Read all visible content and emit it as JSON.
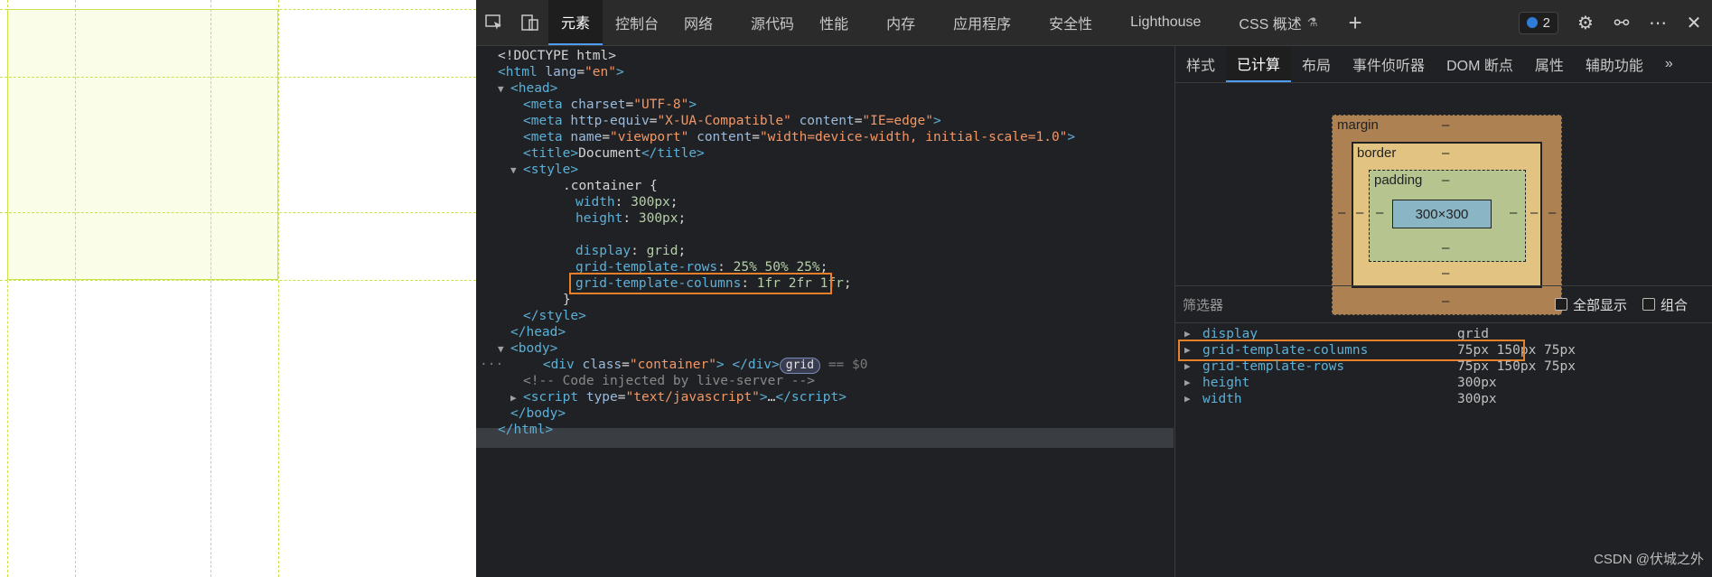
{
  "devtools": {
    "tabs": [
      "元素",
      "控制台",
      "网络",
      "源代码",
      "性能",
      "内存",
      "应用程序",
      "安全性",
      "Lighthouse",
      "CSS 概述"
    ],
    "active_tab": "元素",
    "issues_count": "2"
  },
  "source": {
    "doctype": "<!DOCTYPE html>",
    "html_open": "html",
    "html_lang_attr": "lang",
    "html_lang_val": "\"en\"",
    "head": "head",
    "meta1": {
      "attr": "charset",
      "val": "\"UTF-8\""
    },
    "meta2": {
      "attr1": "http-equiv",
      "val1": "\"X-UA-Compatible\"",
      "attr2": "content",
      "val2": "\"IE=edge\""
    },
    "meta3": {
      "attr1": "name",
      "val1": "\"viewport\"",
      "attr2": "content",
      "val2": "\"width=device-width, initial-scale=1.0\""
    },
    "title_text": "Document",
    "style": "style",
    "css_selector": ".container {",
    "css_rules": [
      {
        "prop": "width",
        "val": "300px"
      },
      {
        "prop": "height",
        "val": "300px"
      },
      {
        "prop": "display",
        "val": "grid"
      },
      {
        "prop": "grid-template-rows",
        "val": "25% 50% 25%"
      },
      {
        "prop": "grid-template-columns",
        "val": "1fr 2fr 1fr"
      }
    ],
    "css_close": "}",
    "body": "body",
    "div_class": "\"container\"",
    "grid_pill": "grid",
    "dollar": "== $0",
    "comment": "<!-- Code injected by live-server -->",
    "script_type": "\"text/javascript\"",
    "ellipsis": "…"
  },
  "right_panel": {
    "tabs": [
      "样式",
      "已计算",
      "布局",
      "事件侦听器",
      "DOM 断点",
      "属性",
      "辅助功能"
    ],
    "active_tab": "已计算",
    "box_model": {
      "margin_label": "margin",
      "border_label": "border",
      "padding_label": "padding",
      "content": "300×300",
      "dash": "–"
    },
    "filter_placeholder": "筛选器",
    "show_all_label": "全部显示",
    "group_label": "组合",
    "computed": [
      {
        "name": "display",
        "value": "grid"
      },
      {
        "name": "grid-template-columns",
        "value": "75px 150px 75px"
      },
      {
        "name": "grid-template-rows",
        "value": "75px 150px 75px"
      },
      {
        "name": "height",
        "value": "300px"
      },
      {
        "name": "width",
        "value": "300px"
      }
    ]
  },
  "watermark": "CSDN @伏城之外",
  "colors": {
    "highlight": "#e8802b",
    "grid_line": "#c9e24a"
  }
}
